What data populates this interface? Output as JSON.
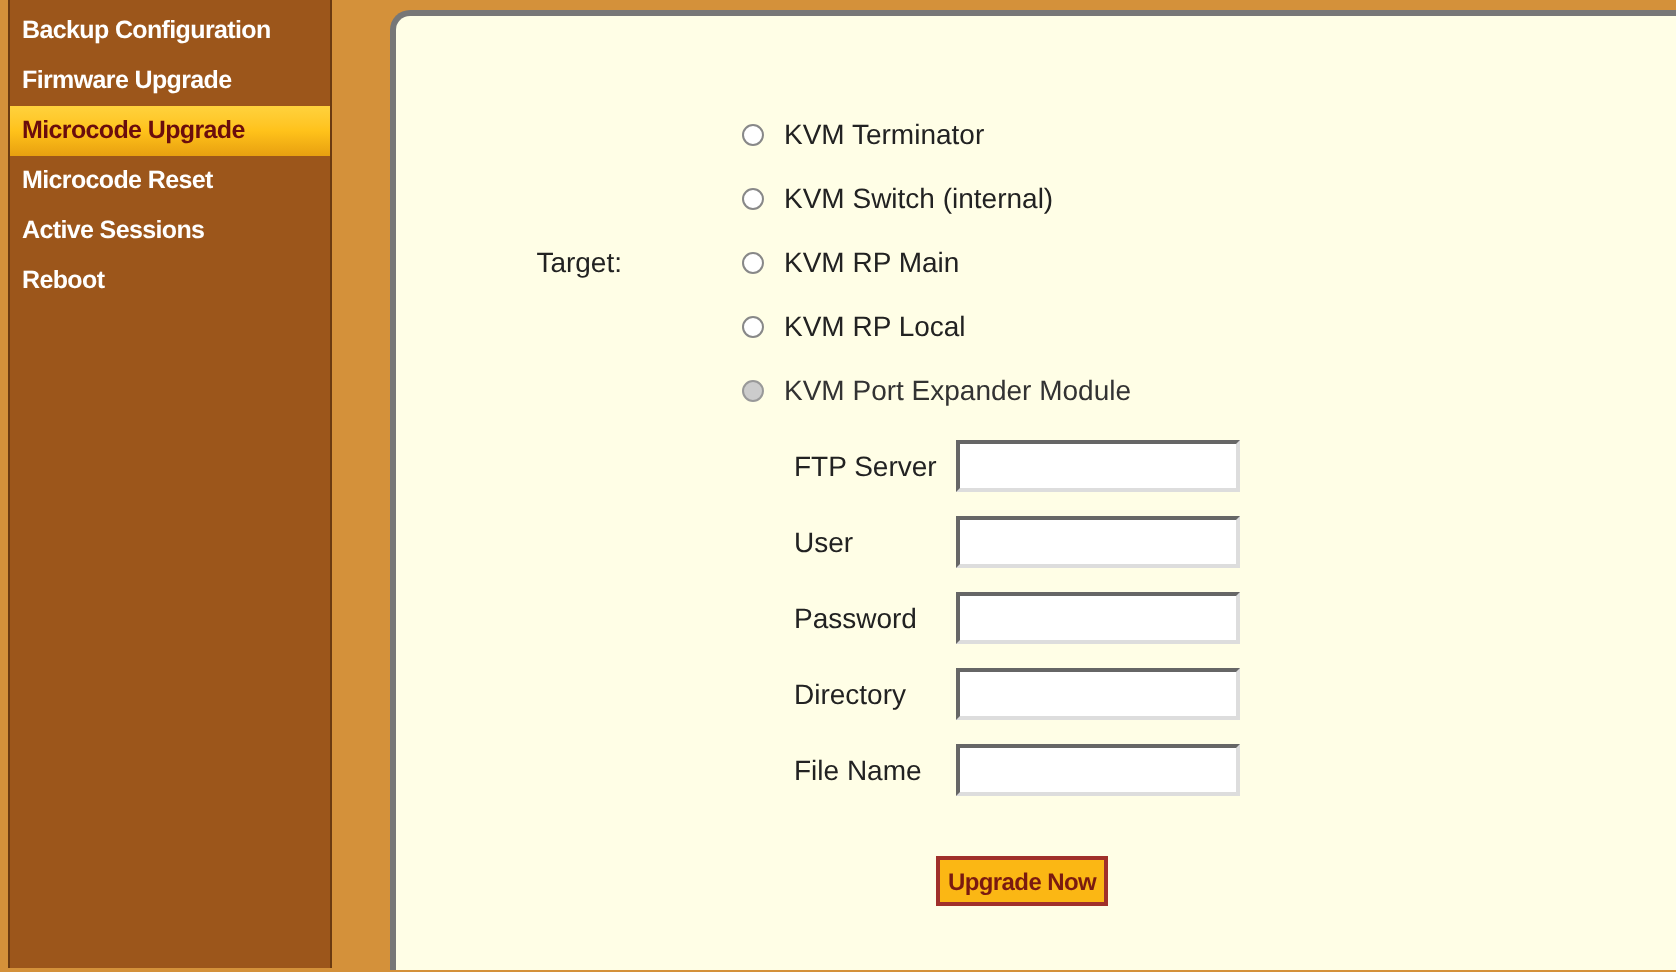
{
  "sidebar": {
    "items": [
      {
        "label": "Backup Configuration",
        "selected": false
      },
      {
        "label": "Firmware Upgrade",
        "selected": false
      },
      {
        "label": "Microcode Upgrade",
        "selected": true
      },
      {
        "label": "Microcode Reset",
        "selected": false
      },
      {
        "label": "Active Sessions",
        "selected": false
      },
      {
        "label": "Reboot",
        "selected": false
      }
    ]
  },
  "form": {
    "target_label": "Target:",
    "targets": [
      {
        "label": "KVM Terminator",
        "selected": false,
        "disabled": false
      },
      {
        "label": "KVM Switch (internal)",
        "selected": false,
        "disabled": false
      },
      {
        "label": "KVM RP Main",
        "selected": false,
        "disabled": false
      },
      {
        "label": "KVM RP Local",
        "selected": false,
        "disabled": false
      },
      {
        "label": "KVM Port Expander Module",
        "selected": false,
        "disabled": true
      }
    ],
    "fields": [
      {
        "label": "FTP Server"
      },
      {
        "label": "User"
      },
      {
        "label": "Password"
      },
      {
        "label": "Directory"
      },
      {
        "label": "File Name"
      }
    ],
    "button": "Upgrade Now"
  }
}
